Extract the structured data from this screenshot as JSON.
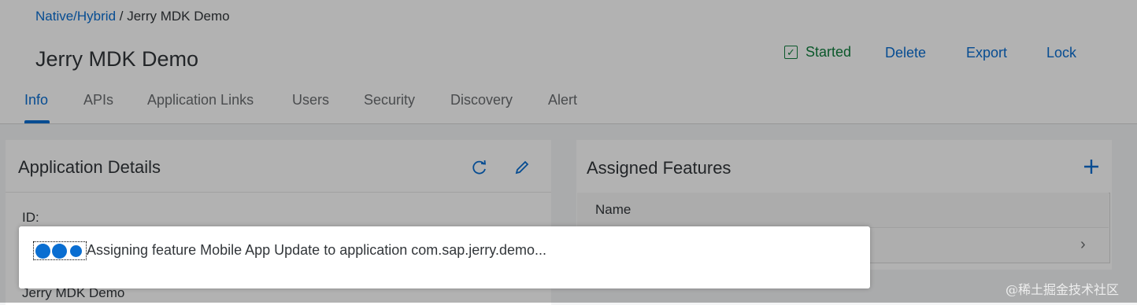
{
  "breadcrumb": {
    "link": "Native/Hybrid",
    "separator": " / ",
    "current": "Jerry MDK Demo"
  },
  "title": "Jerry MDK Demo",
  "header_actions": {
    "started": "Started",
    "delete": "Delete",
    "export": "Export",
    "lock": "Lock"
  },
  "tabs": [
    {
      "label": "Info",
      "active": true
    },
    {
      "label": "APIs"
    },
    {
      "label": "Application Links"
    },
    {
      "label": "Users"
    },
    {
      "label": "Security"
    },
    {
      "label": "Discovery"
    },
    {
      "label": "Alert"
    }
  ],
  "application_details": {
    "title": "Application Details",
    "id_label": "ID:",
    "name_value": "Jerry MDK Demo",
    "icons": [
      "refresh-icon",
      "edit-icon"
    ]
  },
  "assigned_features": {
    "title": "Assigned Features",
    "column_name": "Name",
    "add_icon": "plus-icon"
  },
  "busy_dialog": {
    "text": "Assigning feature Mobile App Update to application com.sap.jerry.demo..."
  },
  "watermark": "@稀土掘金技术社区",
  "colors": {
    "accent": "#0a6ed1",
    "success": "#107e3e",
    "text": "#32363a"
  }
}
